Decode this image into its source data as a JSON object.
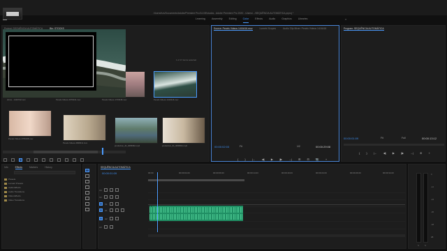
{
  "app": {
    "title": "/Users/hzs/Documents/Adobe/Premiere Pro/14.0/Estudos - Adobe Premiere Pro 2020 - /Users/.../SEQUÊNCIA AUTOMÁTICA.prproj *"
  },
  "workspaces": [
    "Learning",
    "Assembly",
    "Editing",
    "Color",
    "Effects",
    "Audio",
    "Graphics",
    "Libraries"
  ],
  "workspaces_active": "Color",
  "workspaces_more": "»",
  "project": {
    "tabs": [
      "Project: SEQUÊNCIA AUTOMÁTICA",
      "Bin: STOCKS"
    ],
    "clip_name": "Pexels Videos 1416416.mov",
    "clip_info_1": "Movie, 4096 x 2160 (1.0)",
    "clip_info_2": "00:00:09:08, 23,976p",
    "clip_info_3": "48000 Hz - Stereo",
    "path": "SEQUÊNCIA AUTOMÁTICA.prproj\\STOCKS",
    "search_placeholder": "",
    "items_count": "1 of 17 items selected",
    "clips": [
      {
        "name": "drone - 1416742.mov"
      },
      {
        "name": "Pexels Videos 2076431.mov"
      },
      {
        "name": "Pexels Videos 1723048.mov"
      },
      {
        "name": "Pexels Videos 1416416.mov"
      },
      {
        "name": "Pexels Videos 2795168.mov"
      },
      {
        "name": "Pexels Videos 2848411.mov"
      },
      {
        "name": "production_ID_4065962.mp4"
      },
      {
        "name": "production_ID_4065844.mp4"
      }
    ]
  },
  "source": {
    "tabs": [
      "Source: Pexels Videos 1416416.mov",
      "Lumetri Scopes",
      "Audio Clip Mixer: Pexels Videos 1416416"
    ],
    "timecode": "00:00:02:03",
    "fit": "Fit",
    "zoom": "1/2",
    "duration": "00:00:29:08",
    "controls": [
      "{",
      "}",
      "|←",
      "◀|",
      "▶",
      "|▶",
      "→|",
      "⊞",
      "⊟",
      "📷",
      "+"
    ]
  },
  "program": {
    "tab": "Program: SEQUÊNCIA AUTOMÁTICA",
    "timecode": "00:00:01:09",
    "fit": "Fit",
    "zoom": "Full",
    "duration": "00:00:13:12",
    "controls": [
      "{",
      "}",
      "|←",
      "◀|",
      "▶",
      "|▶",
      "→|",
      "⊕",
      "+"
    ]
  },
  "effects": {
    "tabs": [
      "Info",
      "Effects",
      "Markers",
      "History"
    ],
    "items": [
      "Presets",
      "Lumetri Presets",
      "Audio Effects",
      "Audio Transitions",
      "Video Effects",
      "Video Transitions"
    ]
  },
  "timeline": {
    "sequence": "SEQUÊNCIA AUTOMÁTICA",
    "timecode": "00:00:01:09",
    "ruler": [
      "00:00",
      "00:00:04:23",
      "00:00:09:23",
      "00:00:14:23",
      "00:00:19:23",
      "00:00:24:23",
      "00:00:29:23",
      "00:00:34:23"
    ],
    "tracks": [
      "V3",
      "V2",
      "V1",
      "A1",
      "A2",
      "A3"
    ],
    "audio_clip_label": "fx"
  },
  "meters": {
    "labels": [
      "0",
      "-12",
      "-24",
      "-36",
      "-48",
      "dB"
    ],
    "solo_labels": [
      "S",
      "S"
    ]
  }
}
